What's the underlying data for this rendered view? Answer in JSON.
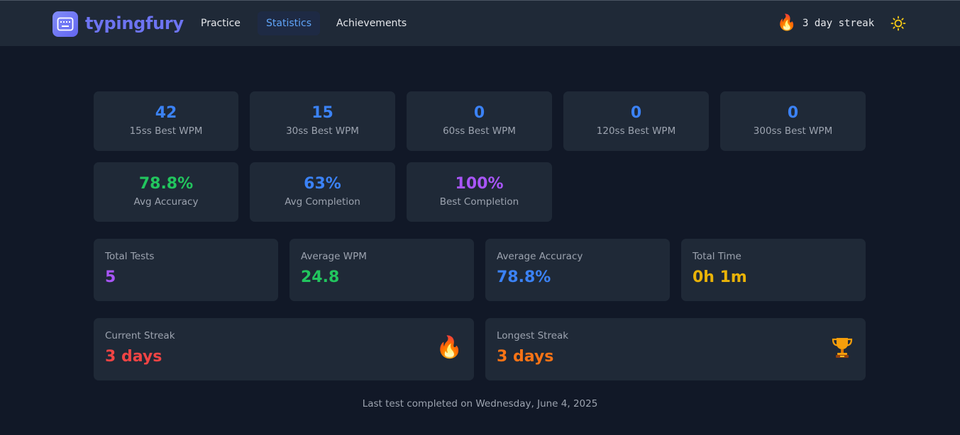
{
  "header": {
    "logo_icon": "keyboard-icon",
    "app_name": "typingfury",
    "nav": [
      {
        "label": "Practice",
        "active": false
      },
      {
        "label": "Statistics",
        "active": true
      },
      {
        "label": "Achievements",
        "active": false
      }
    ],
    "streak_icon": "fire-icon",
    "streak_text": "3 day streak",
    "theme_icon": "sun-icon"
  },
  "best_wpm": [
    {
      "value": "42",
      "label": "15ss Best WPM"
    },
    {
      "value": "15",
      "label": "30ss Best WPM"
    },
    {
      "value": "0",
      "label": "60ss Best WPM"
    },
    {
      "value": "0",
      "label": "120ss Best WPM"
    },
    {
      "value": "0",
      "label": "300ss Best WPM"
    }
  ],
  "averages": [
    {
      "value": "78.8%",
      "label": "Avg Accuracy",
      "color": "#22c55e"
    },
    {
      "value": "63%",
      "label": "Avg Completion",
      "color": "#3b82f6"
    },
    {
      "value": "100%",
      "label": "Best Completion",
      "color": "#a855f7"
    }
  ],
  "summary": [
    {
      "label": "Total Tests",
      "value": "5",
      "color": "#a855f7"
    },
    {
      "label": "Average WPM",
      "value": "24.8",
      "color": "#22c55e"
    },
    {
      "label": "Average Accuracy",
      "value": "78.8%",
      "color": "#3b82f6"
    },
    {
      "label": "Total Time",
      "value": "0h 1m",
      "color": "#eab308"
    }
  ],
  "streaks": [
    {
      "label": "Current Streak",
      "value": "3 days",
      "color": "#ef4444",
      "icon": "fire-icon"
    },
    {
      "label": "Longest Streak",
      "value": "3 days",
      "color": "#f97316",
      "icon": "trophy-icon"
    }
  ],
  "footer": "Last test completed on Wednesday, June 4, 2025",
  "colors": {
    "accent_blue": "#3b82f6",
    "background": "#111827",
    "card": "#1f2937"
  }
}
